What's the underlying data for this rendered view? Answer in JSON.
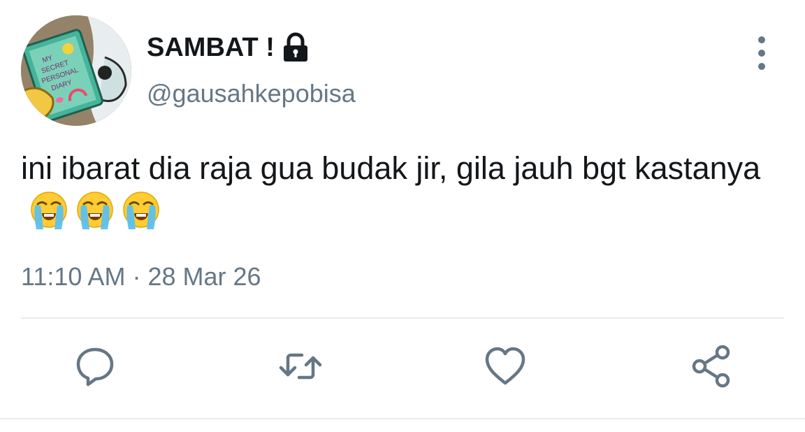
{
  "tweet": {
    "display_name": "SAMBAT !",
    "handle": "@gausahkepobisa",
    "text": "ini ibarat dia raja gua budak jir, gila jauh bgt kastanya",
    "emoji_count": 3,
    "time": "11:10 AM",
    "separator": "·",
    "date": "28 Mar 26"
  },
  "avatar": {
    "lettering": "MY SECRET PERSONAL DIARY"
  },
  "icons": {
    "lock": "lock-icon",
    "more": "more-vertical-icon",
    "reply": "reply-icon",
    "retweet": "retweet-icon",
    "like": "heart-icon",
    "share": "share-icon",
    "emoji": "loudly-crying-face-icon"
  },
  "colors": {
    "text": "#14171a",
    "secondary": "#657786",
    "divider": "#e6ecf0"
  }
}
